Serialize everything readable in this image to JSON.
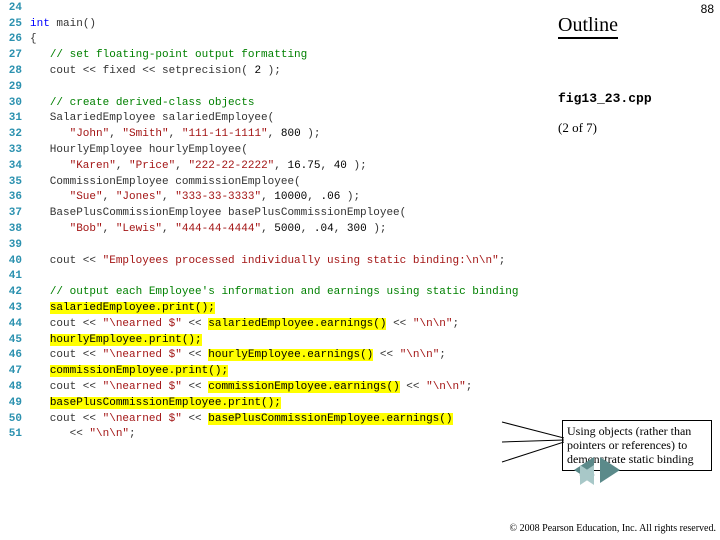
{
  "page_number": "88",
  "outline": "Outline",
  "filename": "fig13_23.cpp",
  "part": "(2 of 7)",
  "callout": "Using objects (rather than pointers or references) to demonstrate static binding",
  "copyright": "© 2008 Pearson Education, Inc. All rights reserved.",
  "code": [
    {
      "n": "24",
      "t": []
    },
    {
      "n": "25",
      "t": [
        {
          "c": "kw",
          "s": "int"
        },
        {
          "c": "nm",
          "s": " main()"
        }
      ]
    },
    {
      "n": "26",
      "t": [
        {
          "c": "nm",
          "s": "{"
        }
      ]
    },
    {
      "n": "27",
      "t": [
        {
          "c": "nm",
          "s": "   "
        },
        {
          "c": "cm",
          "s": "// set floating-point output formatting"
        }
      ]
    },
    {
      "n": "28",
      "t": [
        {
          "c": "nm",
          "s": "   cout << fixed << setprecision( "
        },
        {
          "c": "num",
          "s": "2"
        },
        {
          "c": "nm",
          "s": " );"
        }
      ]
    },
    {
      "n": "29",
      "t": []
    },
    {
      "n": "30",
      "t": [
        {
          "c": "nm",
          "s": "   "
        },
        {
          "c": "cm",
          "s": "// create derived-class objects"
        }
      ]
    },
    {
      "n": "31",
      "t": [
        {
          "c": "nm",
          "s": "   SalariedEmployee salariedEmployee("
        }
      ]
    },
    {
      "n": "32",
      "t": [
        {
          "c": "nm",
          "s": "      "
        },
        {
          "c": "str",
          "s": "\"John\""
        },
        {
          "c": "nm",
          "s": ", "
        },
        {
          "c": "str",
          "s": "\"Smith\""
        },
        {
          "c": "nm",
          "s": ", "
        },
        {
          "c": "str",
          "s": "\"111-11-1111\""
        },
        {
          "c": "nm",
          "s": ", "
        },
        {
          "c": "num",
          "s": "800"
        },
        {
          "c": "nm",
          "s": " );"
        }
      ]
    },
    {
      "n": "33",
      "t": [
        {
          "c": "nm",
          "s": "   HourlyEmployee hourlyEmployee("
        }
      ]
    },
    {
      "n": "34",
      "t": [
        {
          "c": "nm",
          "s": "      "
        },
        {
          "c": "str",
          "s": "\"Karen\""
        },
        {
          "c": "nm",
          "s": ", "
        },
        {
          "c": "str",
          "s": "\"Price\""
        },
        {
          "c": "nm",
          "s": ", "
        },
        {
          "c": "str",
          "s": "\"222-22-2222\""
        },
        {
          "c": "nm",
          "s": ", "
        },
        {
          "c": "num",
          "s": "16.75"
        },
        {
          "c": "nm",
          "s": ", "
        },
        {
          "c": "num",
          "s": "40"
        },
        {
          "c": "nm",
          "s": " );"
        }
      ]
    },
    {
      "n": "35",
      "t": [
        {
          "c": "nm",
          "s": "   CommissionEmployee commissionEmployee("
        }
      ]
    },
    {
      "n": "36",
      "t": [
        {
          "c": "nm",
          "s": "      "
        },
        {
          "c": "str",
          "s": "\"Sue\""
        },
        {
          "c": "nm",
          "s": ", "
        },
        {
          "c": "str",
          "s": "\"Jones\""
        },
        {
          "c": "nm",
          "s": ", "
        },
        {
          "c": "str",
          "s": "\"333-33-3333\""
        },
        {
          "c": "nm",
          "s": ", "
        },
        {
          "c": "num",
          "s": "10000"
        },
        {
          "c": "nm",
          "s": ", "
        },
        {
          "c": "num",
          "s": ".06"
        },
        {
          "c": "nm",
          "s": " );"
        }
      ]
    },
    {
      "n": "37",
      "t": [
        {
          "c": "nm",
          "s": "   BasePlusCommissionEmployee basePlusCommissionEmployee("
        }
      ]
    },
    {
      "n": "38",
      "t": [
        {
          "c": "nm",
          "s": "      "
        },
        {
          "c": "str",
          "s": "\"Bob\""
        },
        {
          "c": "nm",
          "s": ", "
        },
        {
          "c": "str",
          "s": "\"Lewis\""
        },
        {
          "c": "nm",
          "s": ", "
        },
        {
          "c": "str",
          "s": "\"444-44-4444\""
        },
        {
          "c": "nm",
          "s": ", "
        },
        {
          "c": "num",
          "s": "5000"
        },
        {
          "c": "nm",
          "s": ", "
        },
        {
          "c": "num",
          "s": ".04"
        },
        {
          "c": "nm",
          "s": ", "
        },
        {
          "c": "num",
          "s": "300"
        },
        {
          "c": "nm",
          "s": " );"
        }
      ]
    },
    {
      "n": "39",
      "t": []
    },
    {
      "n": "40",
      "t": [
        {
          "c": "nm",
          "s": "   cout << "
        },
        {
          "c": "str",
          "s": "\"Employees processed individually using static binding:\\n\\n\""
        },
        {
          "c": "nm",
          "s": ";"
        }
      ]
    },
    {
      "n": "41",
      "t": []
    },
    {
      "n": "42",
      "t": [
        {
          "c": "nm",
          "s": "   "
        },
        {
          "c": "cm",
          "s": "// output each Employee's information and earnings using static binding"
        }
      ]
    },
    {
      "n": "43",
      "t": [
        {
          "c": "nm",
          "s": "   "
        },
        {
          "c": "hl",
          "s": "salariedEmployee.print();"
        }
      ]
    },
    {
      "n": "44",
      "t": [
        {
          "c": "nm",
          "s": "   cout << "
        },
        {
          "c": "str",
          "s": "\"\\nearned $\""
        },
        {
          "c": "nm",
          "s": " << "
        },
        {
          "c": "hl",
          "s": "salariedEmployee.earnings()"
        },
        {
          "c": "nm",
          "s": " << "
        },
        {
          "c": "str",
          "s": "\"\\n\\n\""
        },
        {
          "c": "nm",
          "s": ";"
        }
      ]
    },
    {
      "n": "45",
      "t": [
        {
          "c": "nm",
          "s": "   "
        },
        {
          "c": "hl",
          "s": "hourlyEmployee.print();"
        }
      ]
    },
    {
      "n": "46",
      "t": [
        {
          "c": "nm",
          "s": "   cout << "
        },
        {
          "c": "str",
          "s": "\"\\nearned $\""
        },
        {
          "c": "nm",
          "s": " << "
        },
        {
          "c": "hl",
          "s": "hourlyEmployee.earnings()"
        },
        {
          "c": "nm",
          "s": " << "
        },
        {
          "c": "str",
          "s": "\"\\n\\n\""
        },
        {
          "c": "nm",
          "s": ";"
        }
      ]
    },
    {
      "n": "47",
      "t": [
        {
          "c": "nm",
          "s": "   "
        },
        {
          "c": "hl",
          "s": "commissionEmployee.print();"
        }
      ]
    },
    {
      "n": "48",
      "t": [
        {
          "c": "nm",
          "s": "   cout << "
        },
        {
          "c": "str",
          "s": "\"\\nearned $\""
        },
        {
          "c": "nm",
          "s": " << "
        },
        {
          "c": "hl",
          "s": "commissionEmployee.earnings()"
        },
        {
          "c": "nm",
          "s": " << "
        },
        {
          "c": "str",
          "s": "\"\\n\\n\""
        },
        {
          "c": "nm",
          "s": ";"
        }
      ]
    },
    {
      "n": "49",
      "t": [
        {
          "c": "nm",
          "s": "   "
        },
        {
          "c": "hl",
          "s": "basePlusCommissionEmployee.print();"
        }
      ]
    },
    {
      "n": "50",
      "t": [
        {
          "c": "nm",
          "s": "   cout << "
        },
        {
          "c": "str",
          "s": "\"\\nearned $\""
        },
        {
          "c": "nm",
          "s": " << "
        },
        {
          "c": "hl",
          "s": "basePlusCommissionEmployee.earnings()"
        }
      ]
    },
    {
      "n": "51",
      "t": [
        {
          "c": "nm",
          "s": "      << "
        },
        {
          "c": "str",
          "s": "\"\\n\\n\""
        },
        {
          "c": "nm",
          "s": ";"
        }
      ]
    }
  ]
}
